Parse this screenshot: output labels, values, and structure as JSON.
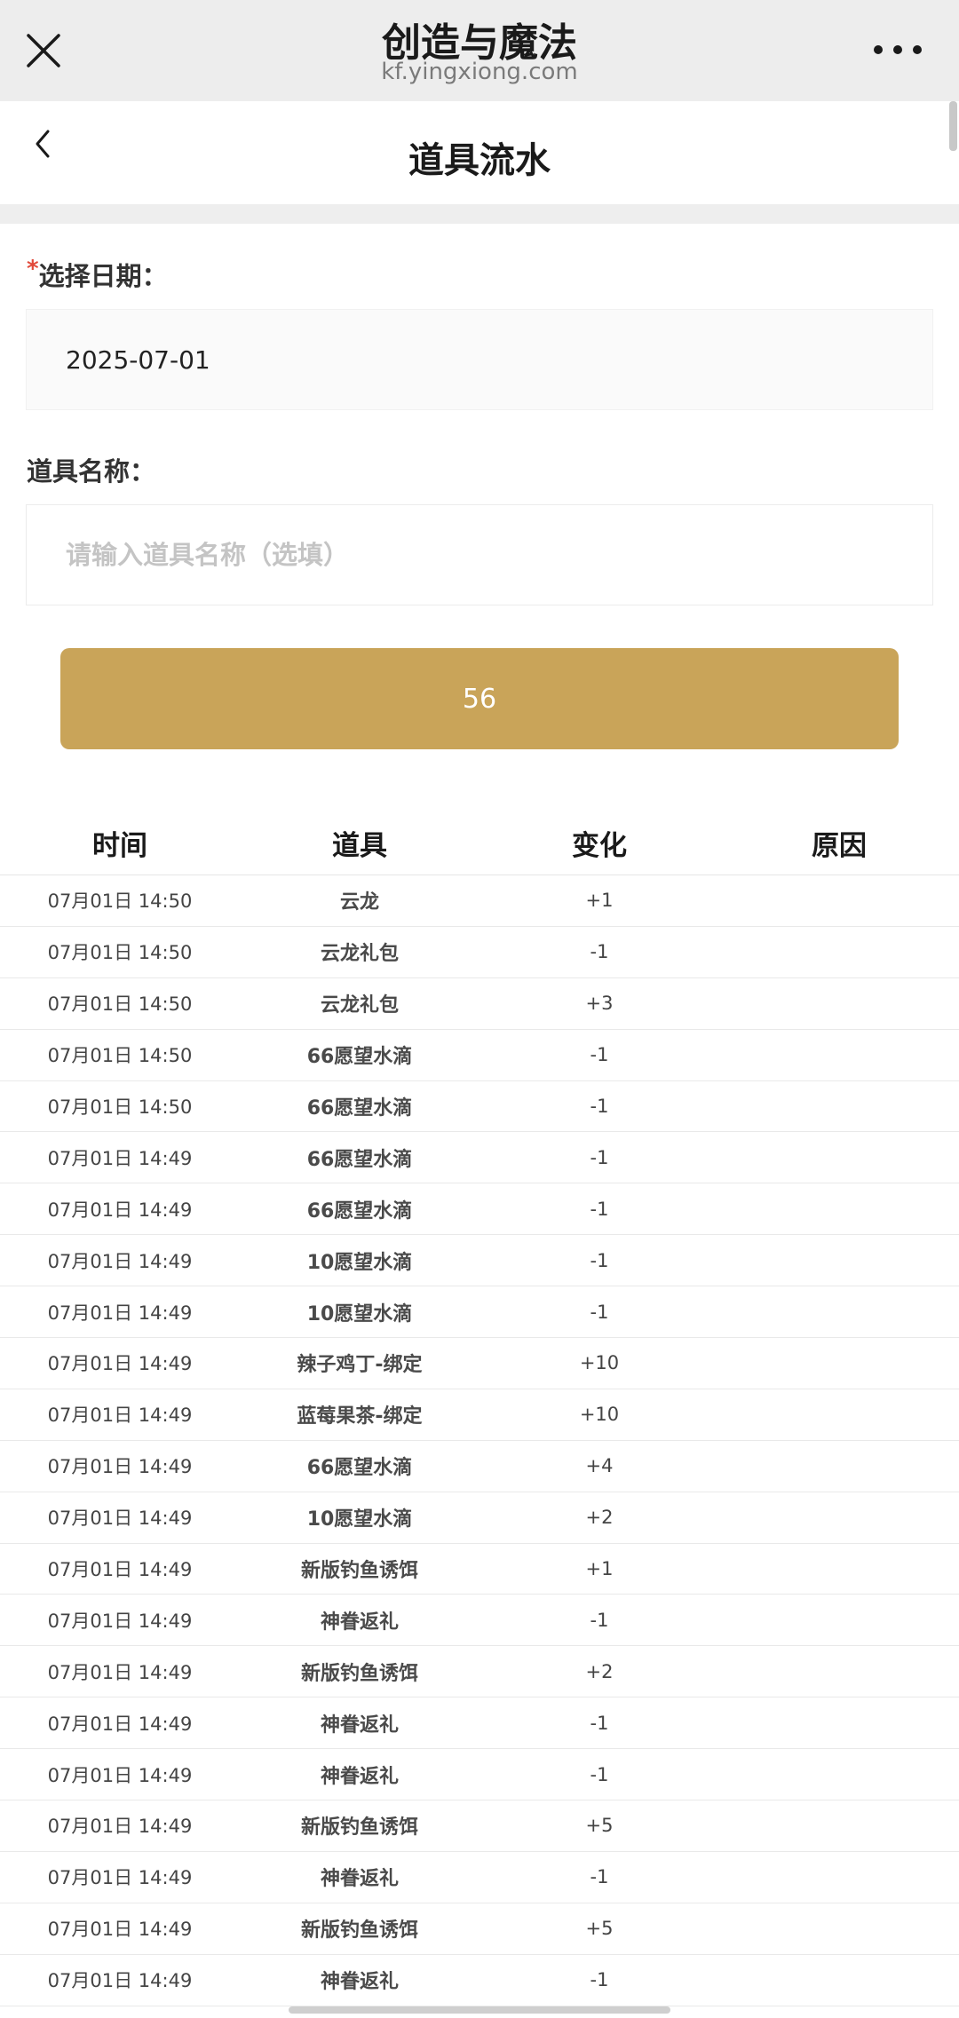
{
  "header": {
    "title": "创造与魔法",
    "url": "kf.yingxiong.com"
  },
  "nav": {
    "title": "道具流水"
  },
  "form": {
    "date_label": "选择日期：",
    "required_mark": "*",
    "date_value": "2025-07-01",
    "name_label": "道具名称：",
    "name_placeholder": "请输入道具名称（选填）",
    "query_button": "56"
  },
  "table": {
    "headers": [
      "时间",
      "道具",
      "变化",
      "原因"
    ],
    "rows": [
      {
        "time": "07月01日 14:50",
        "item": "云龙",
        "change": "+1",
        "reason": ""
      },
      {
        "time": "07月01日 14:50",
        "item": "云龙礼包",
        "change": "-1",
        "reason": ""
      },
      {
        "time": "07月01日 14:50",
        "item": "云龙礼包",
        "change": "+3",
        "reason": ""
      },
      {
        "time": "07月01日 14:50",
        "item": "66愿望水滴",
        "change": "-1",
        "reason": ""
      },
      {
        "time": "07月01日 14:50",
        "item": "66愿望水滴",
        "change": "-1",
        "reason": ""
      },
      {
        "time": "07月01日 14:49",
        "item": "66愿望水滴",
        "change": "-1",
        "reason": ""
      },
      {
        "time": "07月01日 14:49",
        "item": "66愿望水滴",
        "change": "-1",
        "reason": ""
      },
      {
        "time": "07月01日 14:49",
        "item": "10愿望水滴",
        "change": "-1",
        "reason": ""
      },
      {
        "time": "07月01日 14:49",
        "item": "10愿望水滴",
        "change": "-1",
        "reason": ""
      },
      {
        "time": "07月01日 14:49",
        "item": "辣子鸡丁-绑定",
        "change": "+10",
        "reason": ""
      },
      {
        "time": "07月01日 14:49",
        "item": "蓝莓果茶-绑定",
        "change": "+10",
        "reason": ""
      },
      {
        "time": "07月01日 14:49",
        "item": "66愿望水滴",
        "change": "+4",
        "reason": ""
      },
      {
        "time": "07月01日 14:49",
        "item": "10愿望水滴",
        "change": "+2",
        "reason": ""
      },
      {
        "time": "07月01日 14:49",
        "item": "新版钓鱼诱饵",
        "change": "+1",
        "reason": ""
      },
      {
        "time": "07月01日 14:49",
        "item": "神眷返礼",
        "change": "-1",
        "reason": ""
      },
      {
        "time": "07月01日 14:49",
        "item": "新版钓鱼诱饵",
        "change": "+2",
        "reason": ""
      },
      {
        "time": "07月01日 14:49",
        "item": "神眷返礼",
        "change": "-1",
        "reason": ""
      },
      {
        "time": "07月01日 14:49",
        "item": "神眷返礼",
        "change": "-1",
        "reason": ""
      },
      {
        "time": "07月01日 14:49",
        "item": "新版钓鱼诱饵",
        "change": "+5",
        "reason": ""
      },
      {
        "time": "07月01日 14:49",
        "item": "神眷返礼",
        "change": "-1",
        "reason": ""
      },
      {
        "time": "07月01日 14:49",
        "item": "新版钓鱼诱饵",
        "change": "+5",
        "reason": ""
      },
      {
        "time": "07月01日 14:49",
        "item": "神眷返礼",
        "change": "-1",
        "reason": ""
      }
    ]
  },
  "colors": {
    "accent": "#c9a459",
    "required": "#e14a3b"
  }
}
